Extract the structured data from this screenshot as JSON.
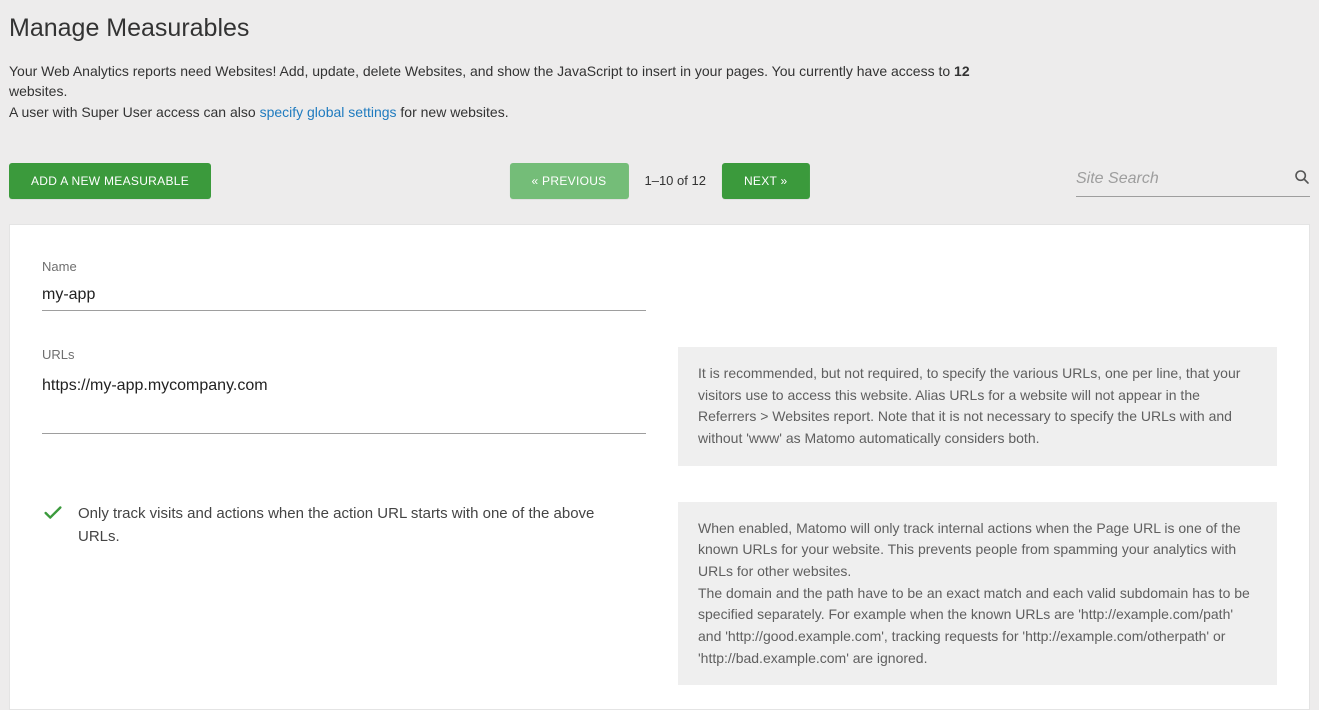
{
  "page": {
    "title": "Manage Measurables",
    "intro_pre": "Your Web Analytics reports need Websites! Add, update, delete Websites, and show the JavaScript to insert in your pages. You currently have access to ",
    "intro_count": "12",
    "intro_post": " websites.",
    "intro_line2_pre": "A user with Super User access can also ",
    "intro_link": "specify global settings",
    "intro_line2_post": " for new websites."
  },
  "controls": {
    "add": "ADD A NEW MEASURABLE",
    "prev": "« PREVIOUS",
    "next": "NEXT »",
    "position": "1–10 of 12",
    "search_placeholder": "Site Search"
  },
  "form": {
    "name_label": "Name",
    "name_value": "my-app",
    "urls_label": "URLs",
    "urls_value": "https://my-app.mycompany.com",
    "urls_hint": "It is recommended, but not required, to specify the various URLs, one per line, that your visitors use to access this website. Alias URLs for a website will not appear in the Referrers > Websites report. Note that it is not necessary to specify the URLs with and without 'www' as Matomo automatically considers both.",
    "only_track_label": "Only track visits and actions when the action URL starts with one of the above URLs.",
    "only_track_hint": "When enabled, Matomo will only track internal actions when the Page URL is one of the known URLs for your website. This prevents people from spamming your analytics with URLs for other websites.\nThe domain and the path have to be an exact match and each valid subdomain has to be specified separately. For example when the known URLs are 'http://example.com/path' and 'http://good.example.com', tracking requests for 'http://example.com/otherpath' or 'http://bad.example.com' are ignored."
  }
}
